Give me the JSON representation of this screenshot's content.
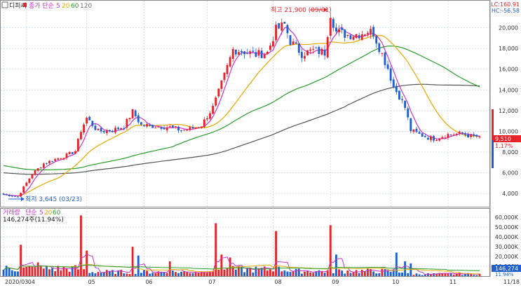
{
  "legend": {
    "symbol": "디피씨",
    "ma_label": "종가 단순",
    "ma_periods": [
      "5",
      "20",
      "60",
      "120"
    ],
    "ma_colors": [
      "#cc33cc",
      "#e6a800",
      "#2a9d2a",
      "#555555"
    ]
  },
  "volume_legend": {
    "title": "거래량",
    "ma_label": "단순",
    "ma_periods": [
      "5",
      "20",
      "60"
    ],
    "value_text": "146,274주(11.94%)"
  },
  "annotations": {
    "high_text": "최고 21,900 (09/01)",
    "low_text": "최저 3,645 (03/23)"
  },
  "right_info": {
    "lc": "LC:160.91",
    "hc": "HC:-56.58",
    "price_badge": "9,510",
    "change_pct": "1.17%",
    "vol_badge": "146,274",
    "vol_pct": "11.94%",
    "date_end": "11/18"
  },
  "colors": {
    "up": "#e8242b",
    "down": "#1f5fd1",
    "ma5": "#cc33cc",
    "ma20": "#e6a800",
    "ma60": "#2a9d2a",
    "ma120": "#555555",
    "grid": "#c9d3e6"
  },
  "chart_data": {
    "type": "candlestick",
    "price_axis": {
      "ticks": [
        4000,
        6000,
        8000,
        10000,
        12000,
        14000,
        16000,
        18000,
        20000
      ],
      "tick_labels": [
        "4,000",
        "6,000",
        "8,000",
        "10,000",
        "12,000",
        "14,000",
        "16,000",
        "18,000",
        "20,000"
      ],
      "ylim": [
        2800,
        22400
      ]
    },
    "volume_axis": {
      "ticks": [
        10000,
        20000,
        30000,
        40000,
        50000,
        60000
      ],
      "tick_labels": [
        "10,000K",
        "20,000K",
        "30,000K",
        "40,000K",
        "50,000K",
        "60,000K"
      ],
      "ylim": [
        0,
        68000
      ]
    },
    "x_labels": [
      {
        "label": "2020/03",
        "index": 0
      },
      {
        "label": "04",
        "index": 8
      },
      {
        "label": "05",
        "index": 29
      },
      {
        "label": "06",
        "index": 49
      },
      {
        "label": "07",
        "index": 71
      },
      {
        "label": "08",
        "index": 94
      },
      {
        "label": "09",
        "index": 114
      },
      {
        "label": "10",
        "index": 135
      },
      {
        "label": "11",
        "index": 155
      }
    ],
    "close_anchors": [
      [
        0,
        3900
      ],
      [
        3,
        3800
      ],
      [
        5,
        3700
      ],
      [
        7,
        4600
      ],
      [
        10,
        5900
      ],
      [
        14,
        6900
      ],
      [
        18,
        7300
      ],
      [
        22,
        7700
      ],
      [
        25,
        8100
      ],
      [
        27,
        10100
      ],
      [
        29,
        11300
      ],
      [
        33,
        10000
      ],
      [
        38,
        10100
      ],
      [
        42,
        10500
      ],
      [
        45,
        11900
      ],
      [
        48,
        10600
      ],
      [
        53,
        10500
      ],
      [
        58,
        10400
      ],
      [
        62,
        10100
      ],
      [
        66,
        10300
      ],
      [
        69,
        10600
      ],
      [
        73,
        12300
      ],
      [
        75,
        13800
      ],
      [
        78,
        16200
      ],
      [
        80,
        17900
      ],
      [
        84,
        17700
      ],
      [
        88,
        17400
      ],
      [
        92,
        17600
      ],
      [
        95,
        19800
      ],
      [
        98,
        20300
      ],
      [
        100,
        18700
      ],
      [
        104,
        17500
      ],
      [
        108,
        17800
      ],
      [
        112,
        17600
      ],
      [
        114,
        21400
      ],
      [
        116,
        19600
      ],
      [
        120,
        19300
      ],
      [
        124,
        19400
      ],
      [
        127,
        19700
      ],
      [
        129,
        19500
      ],
      [
        131,
        18100
      ],
      [
        134,
        16100
      ],
      [
        136,
        14300
      ],
      [
        138,
        13400
      ],
      [
        140,
        12300
      ],
      [
        142,
        10100
      ],
      [
        145,
        9700
      ],
      [
        148,
        9400
      ],
      [
        150,
        9300
      ],
      [
        155,
        9700
      ],
      [
        160,
        9800
      ],
      [
        163,
        9500
      ],
      [
        166,
        9510
      ]
    ],
    "volume_spikes": [
      [
        6,
        32000
      ],
      [
        12,
        14000
      ],
      [
        27,
        62000
      ],
      [
        29,
        26000
      ],
      [
        45,
        30000
      ],
      [
        47,
        21000
      ],
      [
        58,
        15000
      ],
      [
        74,
        54000
      ],
      [
        76,
        22000
      ],
      [
        79,
        19000
      ],
      [
        95,
        46000
      ],
      [
        114,
        52000
      ],
      [
        116,
        22000
      ],
      [
        137,
        24000
      ],
      [
        140,
        15000
      ],
      [
        142,
        13000
      ]
    ]
  }
}
